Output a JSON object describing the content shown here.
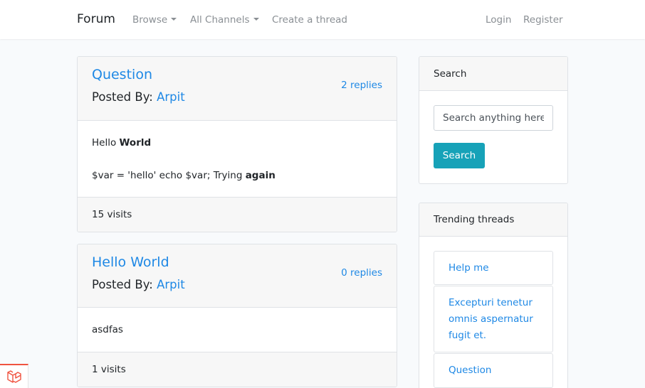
{
  "navbar": {
    "brand": "Forum",
    "browse": "Browse",
    "channels": "All Channels",
    "create": "Create a thread",
    "login": "Login",
    "register": "Register"
  },
  "threads": [
    {
      "title": "Question",
      "posted_by_label": "Posted By:",
      "author": "Arpit",
      "replies": "2 replies",
      "body_line1_plain": "Hello ",
      "body_line1_bold": "World",
      "body_line2_plain": "$var = 'hello' echo $var; Trying ",
      "body_line2_bold": "again",
      "visits": "15 visits"
    },
    {
      "title": "Hello World",
      "posted_by_label": "Posted By:",
      "author": "Arpit",
      "replies": "0 replies",
      "body": "asdfas",
      "visits": "1 visits"
    }
  ],
  "sidebar": {
    "search": {
      "title": "Search",
      "placeholder": "Search anything here",
      "button": "Search"
    },
    "trending": {
      "title": "Trending threads",
      "items": [
        "Help me",
        "Excepturi tenetur omnis aspernatur fugit et.",
        "Question"
      ]
    }
  },
  "icons": {
    "laravel": "laravel-logo-icon",
    "caret": "caret-down-icon"
  },
  "colors": {
    "link": "#1e88e5",
    "button": "#17a2b8",
    "laravel": "#f05340"
  }
}
